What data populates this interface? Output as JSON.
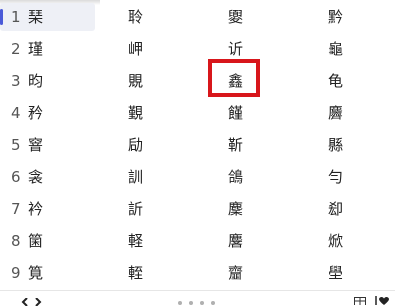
{
  "candidates": {
    "rows": [
      {
        "number": "1",
        "columns": [
          "琹",
          "聆",
          "夓",
          "黔"
        ]
      },
      {
        "number": "2",
        "columns": [
          "瑾",
          "岬",
          "䜣",
          "龜"
        ]
      },
      {
        "number": "3",
        "columns": [
          "昀",
          "覞",
          "鑫",
          "龟"
        ]
      },
      {
        "number": "4",
        "columns": [
          "矜",
          "覲",
          "饉",
          "麡"
        ]
      },
      {
        "number": "5",
        "columns": [
          "窨",
          "劶",
          "靳",
          "縣"
        ]
      },
      {
        "number": "6",
        "columns": [
          "衾",
          "訓",
          "鴿",
          "勻"
        ]
      },
      {
        "number": "7",
        "columns": [
          "衿",
          "訢",
          "麇",
          "㕁"
        ]
      },
      {
        "number": "8",
        "columns": [
          "箘",
          "軽",
          "麐",
          "焮"
        ]
      },
      {
        "number": "9",
        "columns": [
          "筧",
          "輊",
          "齏",
          "壆"
        ]
      }
    ],
    "selected_row": 1,
    "highlighted": {
      "row": 3,
      "column": 3,
      "color": "#d8161b"
    }
  },
  "colors": {
    "selection_accent": "#4a5ad8",
    "selection_background": "#eef0f6",
    "highlight_border": "#d8161b"
  },
  "footer": {
    "prev_icon": "chevron-left-icon",
    "next_icon": "chevron-right-icon",
    "pager_icon": "pager-dots-icon",
    "layout_icon": "grid-icon",
    "favorite_icon": "heart-icon"
  }
}
